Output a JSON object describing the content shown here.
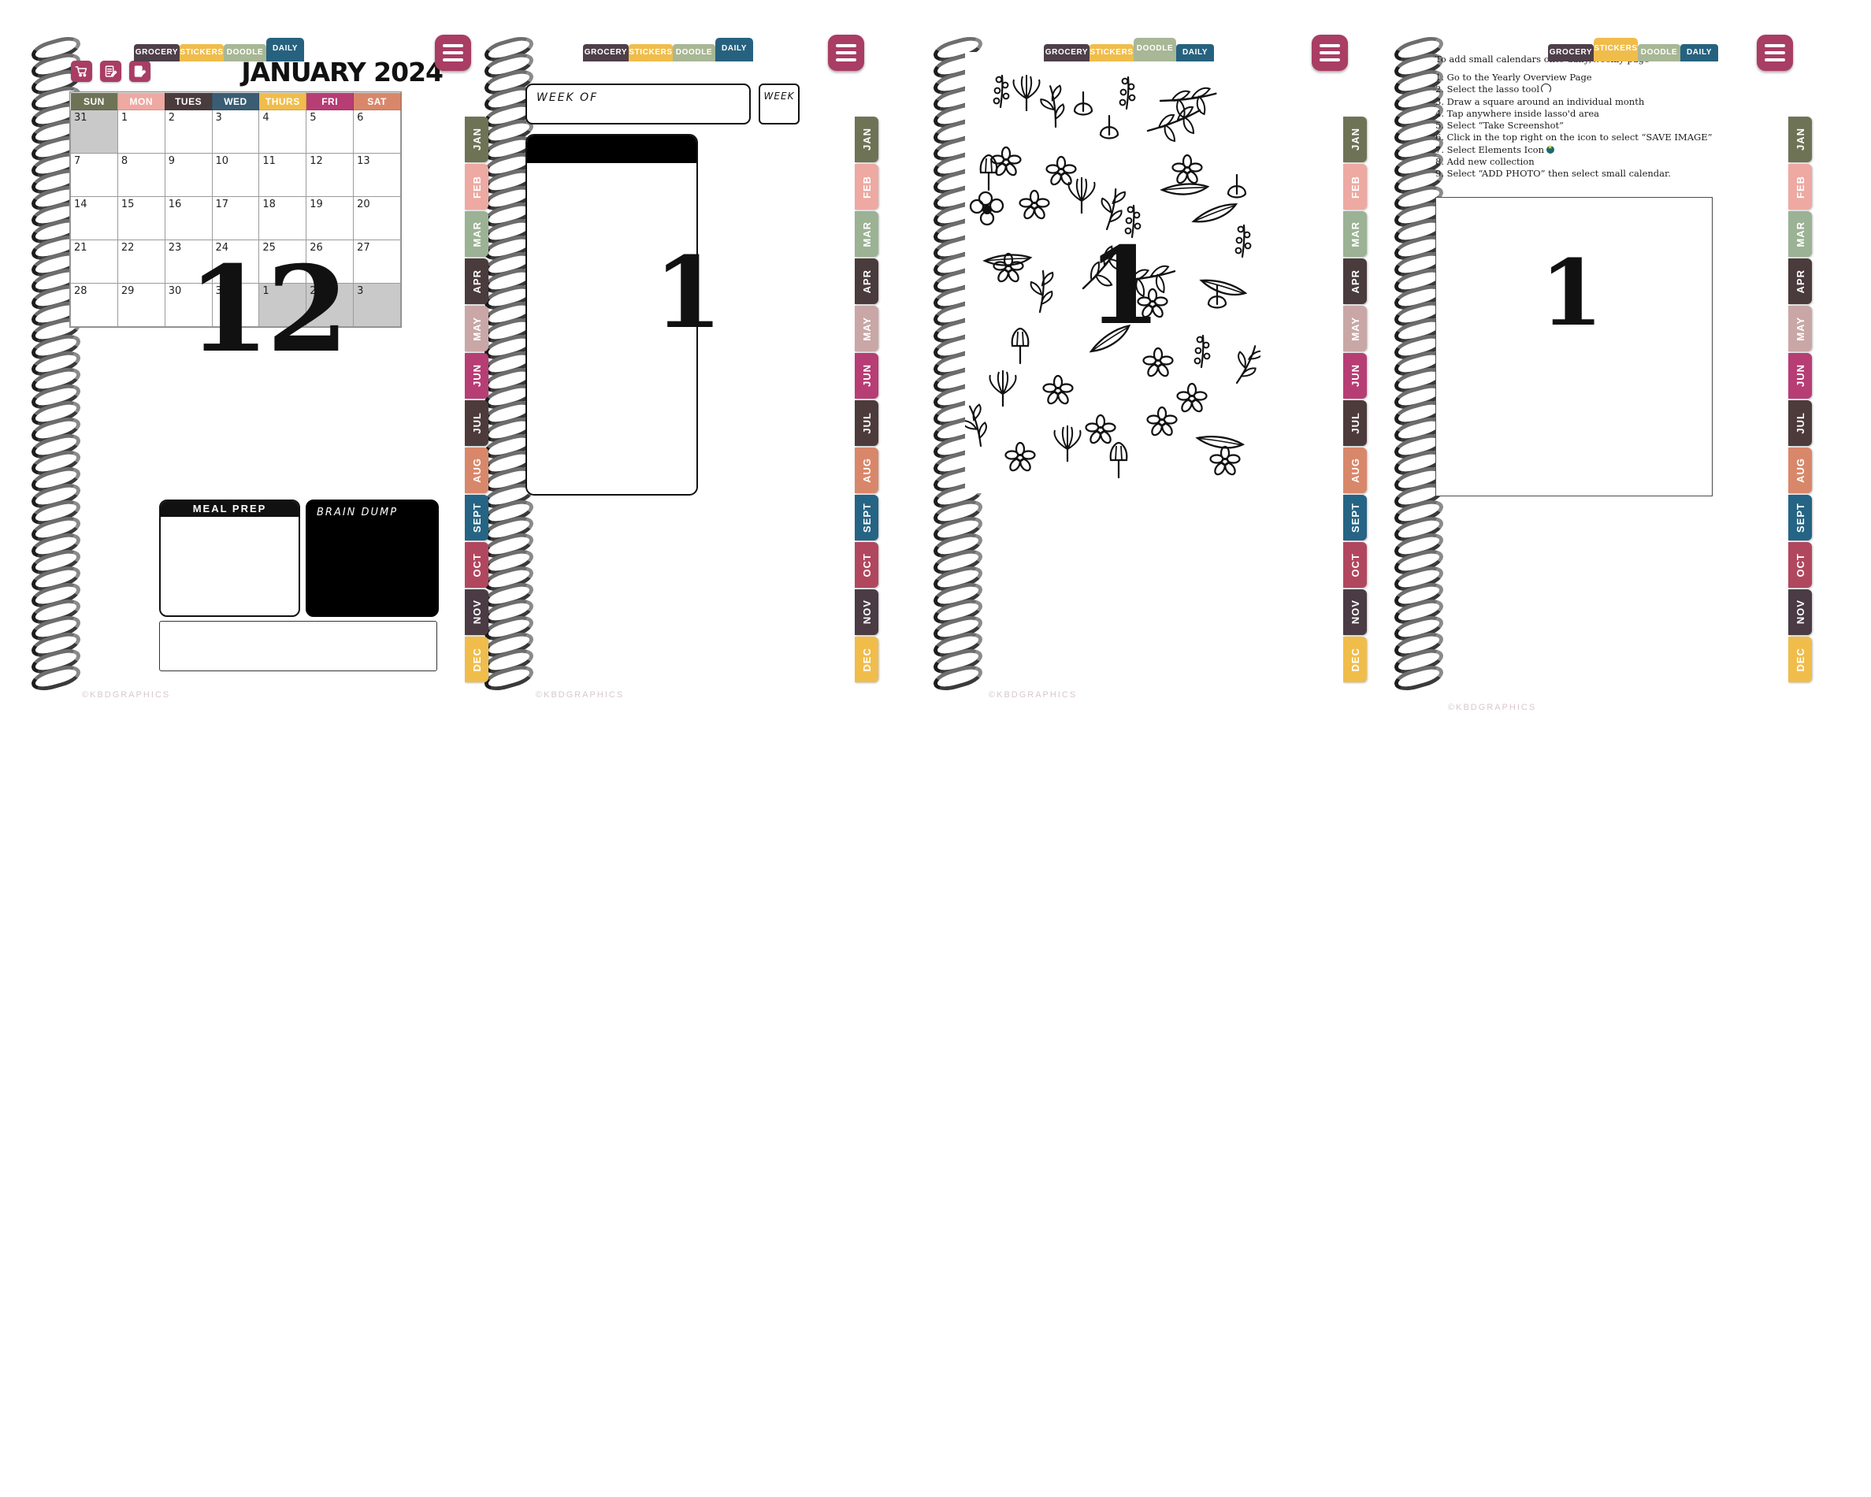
{
  "brand": {
    "copyright": "©KBDGRAPHICS"
  },
  "colors": {
    "accent": "#a93d63",
    "grocery": "#4e3f4a",
    "stickers": "#f0bd4b",
    "doodle": "#a8b795",
    "daily": "#26627f",
    "ink": "#111111",
    "shaded_day": "#c9c9c9"
  },
  "nav_tabs": [
    {
      "label": "GROCERY",
      "color": "#4e3f4a",
      "width": 58
    },
    {
      "label": "STICKERS",
      "color": "#f0bd4b",
      "width": 56
    },
    {
      "label": "DOODLE",
      "color": "#a8b795",
      "width": 54
    },
    {
      "label": "DAILY",
      "color": "#26627f",
      "width": 48
    }
  ],
  "month_tabs": [
    {
      "label": "JAN",
      "color": "#6e7356"
    },
    {
      "label": "FEB",
      "color": "#eda9a2"
    },
    {
      "label": "MAR",
      "color": "#9bb294"
    },
    {
      "label": "APR",
      "color": "#4a3b3c"
    },
    {
      "label": "MAY",
      "color": "#c9a7a6"
    },
    {
      "label": "JUN",
      "color": "#b73d75"
    },
    {
      "label": "JUL",
      "color": "#4d3b3c"
    },
    {
      "label": "AUG",
      "color": "#d9876a"
    },
    {
      "label": "SEPT",
      "color": "#256484"
    },
    {
      "label": "OCT",
      "color": "#b1475f"
    },
    {
      "label": "NOV",
      "color": "#4a3b44"
    },
    {
      "label": "DEC",
      "color": "#f0bd4b"
    }
  ],
  "hamburger": {
    "name": "menu"
  },
  "pages": [
    {
      "id": "monthly-calendar",
      "active_tab": "DAILY",
      "toolbar_icons": [
        {
          "name": "grocery-cart-icon"
        },
        {
          "name": "checklist-icon"
        },
        {
          "name": "notepad-icon"
        }
      ],
      "title": "JANUARY 2024",
      "big_date": "12",
      "calendar": {
        "weekday_headers": [
          {
            "label": "SUN",
            "color": "#6e7356"
          },
          {
            "label": "MON",
            "color": "#eda9a2"
          },
          {
            "label": "TUES",
            "color": "#4a3b3c"
          },
          {
            "label": "WED",
            "color": "#3a5d73"
          },
          {
            "label": "THURS",
            "color": "#f0bd4b"
          },
          {
            "label": "FRI",
            "color": "#b73d75"
          },
          {
            "label": "SAT",
            "color": "#d9876a"
          }
        ],
        "weeks": [
          [
            {
              "d": "31",
              "off": true
            },
            {
              "d": "1"
            },
            {
              "d": "2"
            },
            {
              "d": "3"
            },
            {
              "d": "4"
            },
            {
              "d": "5"
            },
            {
              "d": "6"
            }
          ],
          [
            {
              "d": "7"
            },
            {
              "d": "8"
            },
            {
              "d": "9"
            },
            {
              "d": "10"
            },
            {
              "d": "11"
            },
            {
              "d": "12"
            },
            {
              "d": "13"
            }
          ],
          [
            {
              "d": "14"
            },
            {
              "d": "15"
            },
            {
              "d": "16"
            },
            {
              "d": "17"
            },
            {
              "d": "18"
            },
            {
              "d": "19"
            },
            {
              "d": "20"
            }
          ],
          [
            {
              "d": "21"
            },
            {
              "d": "22"
            },
            {
              "d": "23"
            },
            {
              "d": "24"
            },
            {
              "d": "25"
            },
            {
              "d": "26"
            },
            {
              "d": "27"
            }
          ],
          [
            {
              "d": "28"
            },
            {
              "d": "29"
            },
            {
              "d": "30"
            },
            {
              "d": "31"
            },
            {
              "d": "1",
              "off": true
            },
            {
              "d": "2",
              "off": true
            },
            {
              "d": "3",
              "off": true
            }
          ]
        ]
      },
      "meal_prep_label": "MEAL PREP",
      "brain_dump_label": "BRAIN DUMP"
    },
    {
      "id": "weekly-page",
      "active_tab": "DAILY",
      "week_of_label": "WEEK OF",
      "week_number_label": "WEEK",
      "big_date": "1"
    },
    {
      "id": "doodle-page",
      "active_tab": "DOODLE",
      "big_date": "1"
    },
    {
      "id": "stickers-instructions-page",
      "active_tab": "STICKERS",
      "instructions_heading": "To add small calendars onto daily/weekly page",
      "instructions": [
        "1. Go to the Yearly Overview Page",
        "2. Select the lasso tool",
        "3. Draw a square around an individual month",
        "4. Tap anywhere inside lasso'd area",
        "5. Select “Take Screenshot”",
        "6. Click in the top right on the icon to select “SAVE IMAGE”",
        "7. Select Elements Icon",
        "8. Add new collection",
        "9. Select “ADD PHOTO” then select small calendar."
      ],
      "big_date": "1"
    }
  ]
}
